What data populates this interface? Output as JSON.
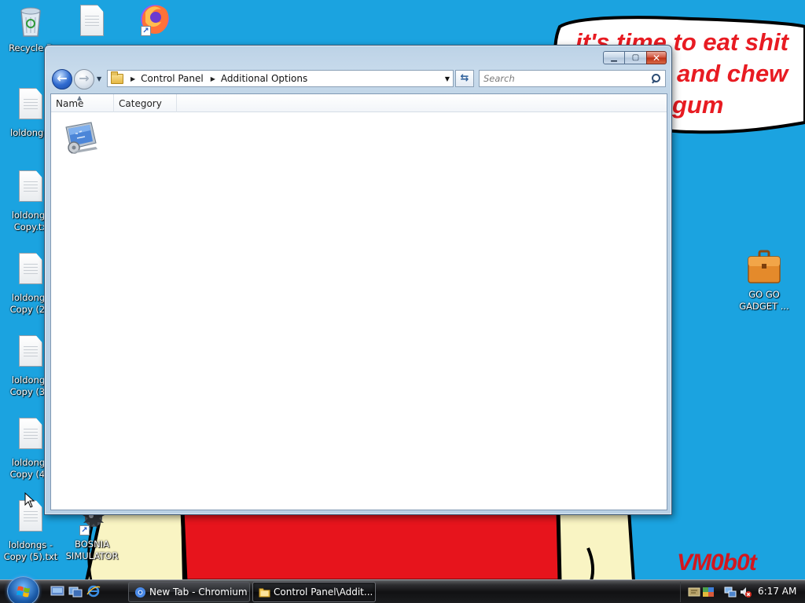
{
  "wallpaper": {
    "speech_lines": [
      "it's time to eat shit",
      "and chew",
      "gum"
    ],
    "signature": "VM0b0t"
  },
  "desktop_icons": [
    {
      "label": "Recycle B",
      "icon": "recycle-bin-icon"
    },
    {
      "label": "",
      "icon": "text-file-icon"
    },
    {
      "label": "",
      "icon": "firefox-icon"
    },
    {
      "label": "loldongs.",
      "icon": "text-file-icon"
    },
    {
      "label": "loldongs\nCopy.tx",
      "icon": "text-file-icon"
    },
    {
      "label": "loldongs\nCopy (2).",
      "icon": "text-file-icon"
    },
    {
      "label": "loldongs\nCopy (3).",
      "icon": "text-file-icon"
    },
    {
      "label": "loldongs\nCopy (4).",
      "icon": "text-file-icon"
    },
    {
      "label": "loldongs -\nCopy (5).txt",
      "icon": "text-file-icon"
    },
    {
      "label": "BOSNIA\nSIMULATOR",
      "icon": "bosnia-simulator-icon"
    },
    {
      "label": "GO GO\nGADGET ...",
      "icon": "briefcase-icon"
    }
  ],
  "window": {
    "breadcrumb": [
      "Control Panel",
      "Additional Options"
    ],
    "search_placeholder": "Search",
    "columns": [
      "Name",
      "Category"
    ],
    "items": [
      {
        "name": "",
        "icon": "control-panel-options-icon"
      }
    ]
  },
  "taskbar": {
    "quick_launch": [
      "show-desktop-icon",
      "switch-windows-icon",
      "internet-explorer-icon"
    ],
    "tasks": [
      {
        "label": "New Tab - Chromium",
        "icon": "chromium-icon",
        "active": false
      },
      {
        "label": "Control Panel\\Addit...",
        "icon": "folder-icon",
        "active": true
      }
    ],
    "tray_icons": [
      "tray-app-icon",
      "tray-network-icon",
      "tray-network2-icon",
      "volume-muted-icon"
    ],
    "clock": "6:17 AM"
  }
}
